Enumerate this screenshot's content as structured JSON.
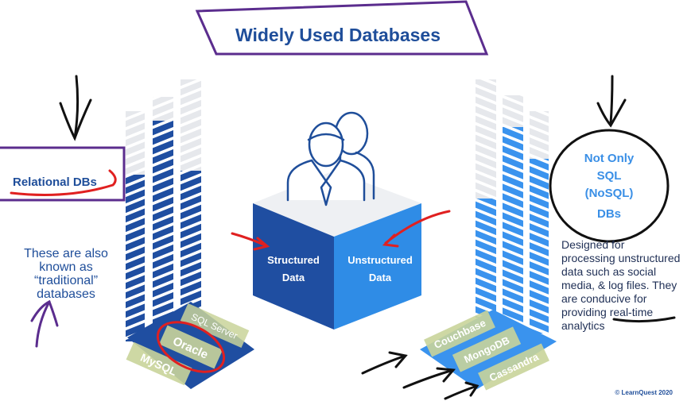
{
  "title": "Widely Used Databases",
  "left": {
    "box_label": "Relational DBs",
    "note_lines": [
      "These are also",
      "known as",
      "“traditional”",
      "databases"
    ],
    "products": [
      "SQL Server",
      "Oracle",
      "MySQL"
    ]
  },
  "center": {
    "left_face": [
      "Structured",
      "Data"
    ],
    "right_face": [
      "Unstructured",
      "Data"
    ],
    "icon": "users-icon"
  },
  "right": {
    "circle_lines": [
      "Not Only",
      "SQL",
      "(NoSQL)",
      "DBs"
    ],
    "note_lines": [
      "Designed for",
      "processing unstructured",
      "data such as social",
      "media, & log files. They",
      "are conducive for",
      "providing real-time",
      "analytics"
    ],
    "products": [
      "Couchbase",
      "MongoDB",
      "Cassandra"
    ]
  },
  "copyright": "© LearnQuest 2020",
  "colors": {
    "title": "#1f4e9a",
    "dark_blue": "#1f4ea1",
    "light_blue": "#2f8ce6",
    "annotation_ink": "#111111",
    "annotation_red": "#e02020",
    "purple": "#5b2d8e",
    "highlight": "#f3f09a"
  }
}
